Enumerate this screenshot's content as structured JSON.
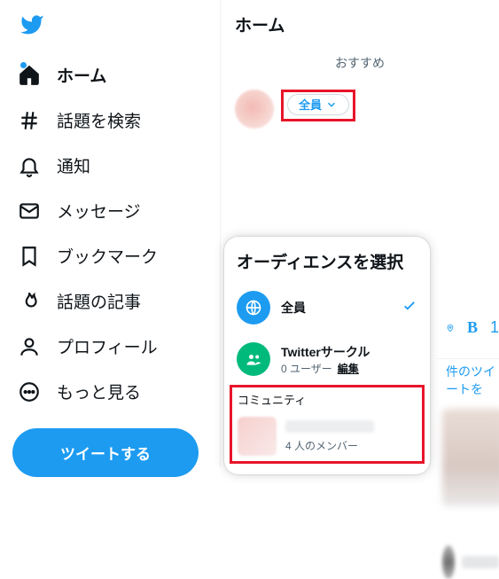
{
  "sidebar": {
    "items": [
      {
        "label": "ホーム"
      },
      {
        "label": "話題を検索"
      },
      {
        "label": "通知"
      },
      {
        "label": "メッセージ"
      },
      {
        "label": "ブックマーク"
      },
      {
        "label": "話題の記事"
      },
      {
        "label": "プロフィール"
      },
      {
        "label": "もっと見る"
      }
    ],
    "tweet_button": "ツイートする"
  },
  "main": {
    "header": "ホーム",
    "recommend_tab": "おすすめ",
    "audience_pill": "全員",
    "reply_hint": "件のツイートを"
  },
  "audience_popover": {
    "title": "オーディエンスを選択",
    "everyone": {
      "label": "全員"
    },
    "circle": {
      "label": "Twitterサークル",
      "count_text": "0 ユーザー",
      "edit": "編集"
    },
    "community_section": "コミュニティ",
    "community_item": {
      "members_text": "4 人のメンバー"
    }
  },
  "compose_icons": {
    "bold": "B",
    "one": "1"
  }
}
